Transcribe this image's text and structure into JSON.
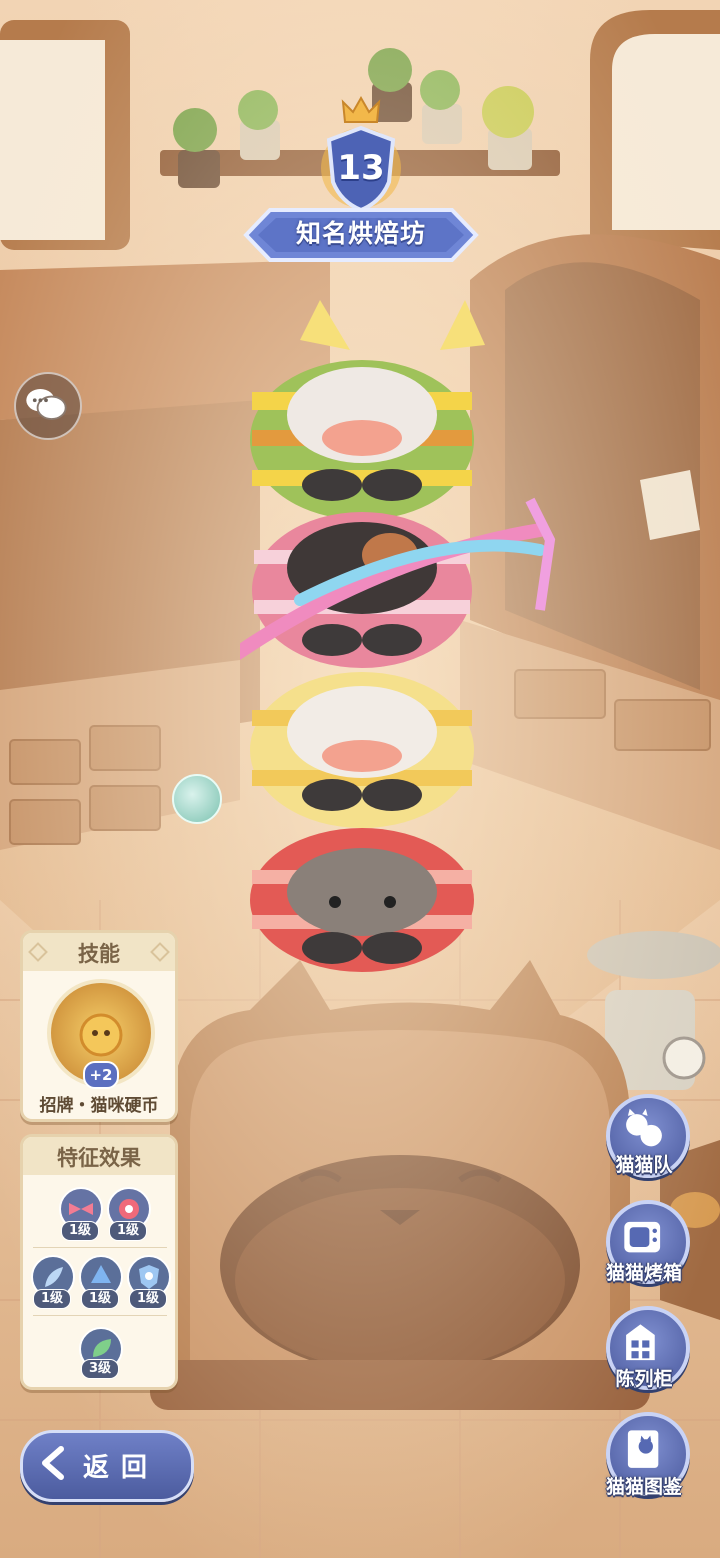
{
  "level": {
    "number": "13",
    "title": "知名烘焙坊"
  },
  "skill_panel": {
    "title": "技能",
    "badge": "+2",
    "skill_name": "招牌・猫咪硬币"
  },
  "trait_panel": {
    "title": "特征效果",
    "rows": [
      [
        {
          "icon": "bow-icon",
          "level": "1级"
        },
        {
          "icon": "flower-icon",
          "level": "1级"
        }
      ],
      [
        {
          "icon": "feather-icon",
          "level": "1级"
        },
        {
          "icon": "drop-icon",
          "level": "1级"
        },
        {
          "icon": "star-shield-icon",
          "level": "1级"
        }
      ],
      [
        {
          "icon": "leaf-icon",
          "level": "3级"
        }
      ]
    ]
  },
  "right_nav": [
    {
      "name": "cat-team",
      "label": "猫猫队"
    },
    {
      "name": "cat-oven",
      "label": "猫猫烤箱"
    },
    {
      "name": "display-cabinet",
      "label": "陈列柜"
    },
    {
      "name": "cat-encyclopedia",
      "label": "猫猫图鉴"
    }
  ],
  "back_button": {
    "label": "返回"
  },
  "colors": {
    "accent_blue": "#5b6db3",
    "panel_bg": "#fdf7ea",
    "wood": "#b57b4c"
  }
}
